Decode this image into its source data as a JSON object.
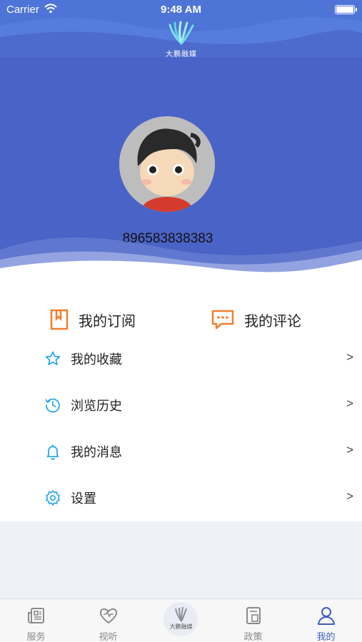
{
  "status_bar": {
    "carrier": "Carrier",
    "time": "9:48 AM"
  },
  "header": {
    "logo_text": "大鹏融媒",
    "logo_icon": "fan-logo-icon"
  },
  "profile": {
    "username": "896583838383",
    "avatar_icon": "cartoon-avatar"
  },
  "quick_links": [
    {
      "label": "我的订阅",
      "icon": "bookmark-icon",
      "color": "#f07f2e"
    },
    {
      "label": "我的评论",
      "icon": "comment-icon",
      "color": "#f07f2e"
    }
  ],
  "menu": [
    {
      "label": "我的收藏",
      "icon": "star-icon",
      "arrow": ">"
    },
    {
      "label": "浏览历史",
      "icon": "history-icon",
      "arrow": ">"
    },
    {
      "label": "我的消息",
      "icon": "bell-icon",
      "arrow": ">"
    },
    {
      "label": "设置",
      "icon": "gear-icon",
      "arrow": ">"
    }
  ],
  "tabs": [
    {
      "label": "服务",
      "icon": "news-icon",
      "active": false
    },
    {
      "label": "视听",
      "icon": "heart-icon",
      "active": false
    },
    {
      "label": "大鹏融媒",
      "icon": "center-logo-icon",
      "active": false
    },
    {
      "label": "政策",
      "icon": "document-icon",
      "active": false
    },
    {
      "label": "我的",
      "icon": "user-icon",
      "active": true
    }
  ],
  "colors": {
    "header_blue": "#4d74d6",
    "banner_blue": "#4a63c6",
    "accent_orange": "#f07f2e",
    "icon_cyan": "#29a9e8",
    "active_tab": "#3d5cc0"
  }
}
